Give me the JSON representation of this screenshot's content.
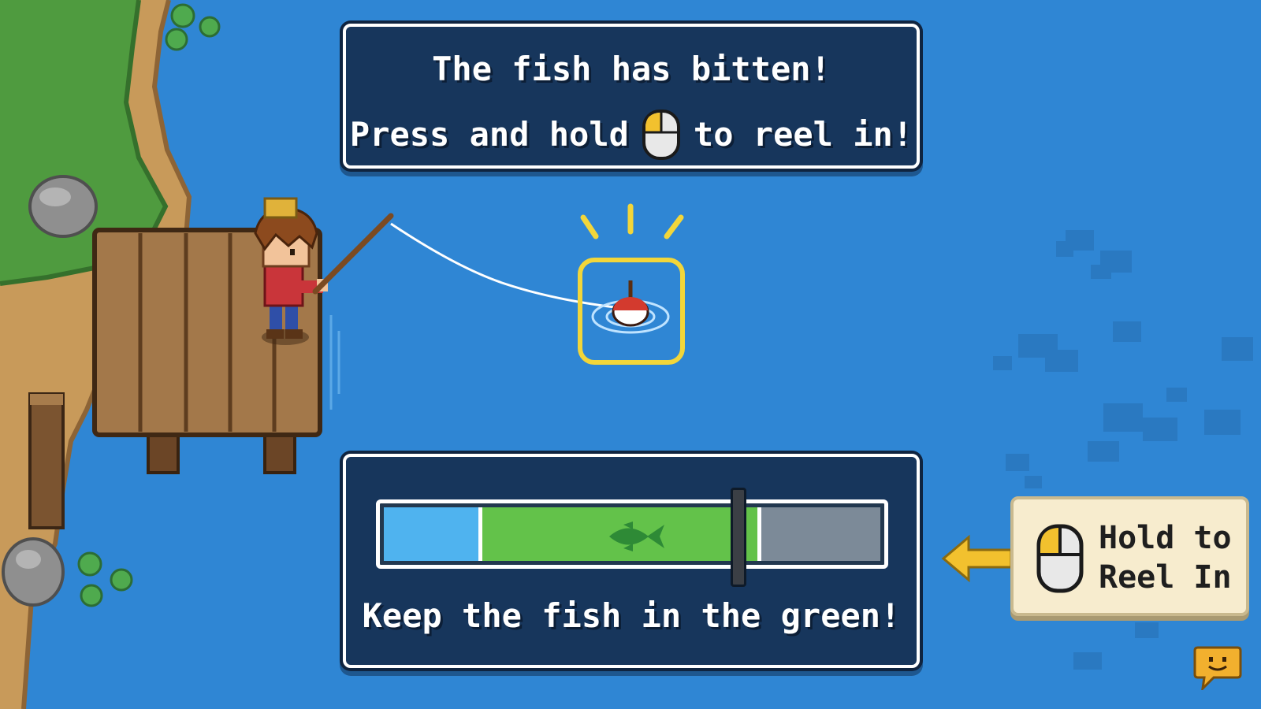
{
  "hud": {
    "bite_title": "The fish has bitten!",
    "instruction_prefix": "Press and hold",
    "instruction_suffix": "to reel in!",
    "meter_caption": "Keep the fish in the green!",
    "tooltip_line1": "Hold to",
    "tooltip_line2": "Reel In"
  },
  "reel_meter": {
    "green_zone_start": 0.19,
    "green_zone_end": 0.76,
    "fish_position": 0.5,
    "cursor_position": 0.71
  },
  "icons": {
    "instruction_icon": "mouse-left-button-icon",
    "tooltip_icon": "mouse-left-button-icon",
    "tooltip_arrow": "arrow-left-icon",
    "meter_fish": "fish-icon",
    "chat": "chat-bubble-icon"
  },
  "colors": {
    "water": "#2f86d4",
    "panel_bg": "#17365c",
    "green_zone": "#63c24a",
    "blue_zone": "#4fb3ef",
    "highlight": "#f2d63a",
    "mouse_button": "#f2c12e"
  }
}
